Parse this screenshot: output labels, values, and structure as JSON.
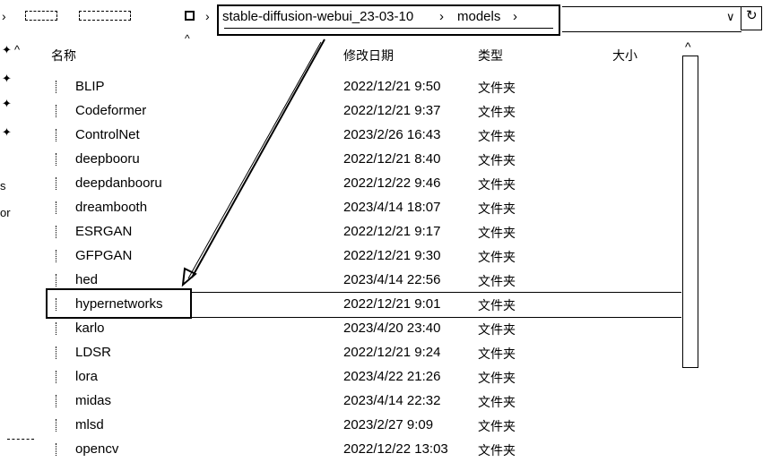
{
  "address_bar": {
    "path": [
      "stable-diffusion-webui_23-03-10",
      "models"
    ],
    "separator": "›",
    "refresh_icon": "refresh-icon",
    "dropdown_icon": "chevron-down-icon"
  },
  "columns": {
    "name": "名称",
    "date": "修改日期",
    "type": "类型",
    "size": "大小"
  },
  "left_nav_fragments": [
    "s",
    "or"
  ],
  "files": [
    {
      "name": "BLIP",
      "date": "2022/12/21 9:50",
      "type": "文件夹"
    },
    {
      "name": "Codeformer",
      "date": "2022/12/21 9:37",
      "type": "文件夹"
    },
    {
      "name": "ControlNet",
      "date": "2023/2/26 16:43",
      "type": "文件夹"
    },
    {
      "name": "deepbooru",
      "date": "2022/12/21 8:40",
      "type": "文件夹"
    },
    {
      "name": "deepdanbooru",
      "date": "2022/12/22 9:46",
      "type": "文件夹"
    },
    {
      "name": "dreambooth",
      "date": "2023/4/14 18:07",
      "type": "文件夹"
    },
    {
      "name": "ESRGAN",
      "date": "2022/12/21 9:17",
      "type": "文件夹"
    },
    {
      "name": "GFPGAN",
      "date": "2022/12/21 9:30",
      "type": "文件夹"
    },
    {
      "name": "hed",
      "date": "2023/4/14 22:56",
      "type": "文件夹"
    },
    {
      "name": "hypernetworks",
      "date": "2022/12/21 9:01",
      "type": "文件夹"
    },
    {
      "name": "karlo",
      "date": "2023/4/20 23:40",
      "type": "文件夹"
    },
    {
      "name": "LDSR",
      "date": "2022/12/21 9:24",
      "type": "文件夹"
    },
    {
      "name": "lora",
      "date": "2023/4/22 21:26",
      "type": "文件夹"
    },
    {
      "name": "midas",
      "date": "2023/4/14 22:32",
      "type": "文件夹"
    },
    {
      "name": "mlsd",
      "date": "2023/2/27 9:09",
      "type": "文件夹"
    },
    {
      "name": "opencv",
      "date": "2022/12/22 13:03",
      "type": "文件夹"
    }
  ],
  "selected_row": 9,
  "colors": {
    "foreground": "#000000",
    "background": "#ffffff"
  }
}
